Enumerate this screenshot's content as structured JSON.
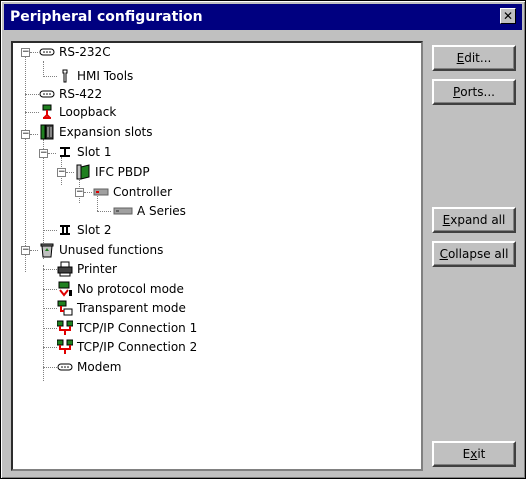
{
  "window": {
    "title": "Peripheral configuration"
  },
  "tree": {
    "rs232c": "RS-232C",
    "hmi_tools": "HMI Tools",
    "rs422": "RS-422",
    "loopback": "Loopback",
    "expansion_slots": "Expansion slots",
    "slot1": "Slot 1",
    "ifc_pbdp": "IFC PBDP",
    "controller": "Controller",
    "a_series": "A Series",
    "slot2": "Slot 2",
    "unused_functions": "Unused functions",
    "printer": "Printer",
    "no_protocol_mode": "No protocol mode",
    "transparent_mode": "Transparent mode",
    "tcpip1": "TCP/IP Connection 1",
    "tcpip2": "TCP/IP Connection 2",
    "modem": "Modem"
  },
  "buttons": {
    "edit_prefix": "E",
    "edit_rest": "dit...",
    "ports_prefix": "P",
    "ports_rest": "orts...",
    "expand_prefix": "E",
    "expand_rest": "xpand all",
    "collapse_prefix": "C",
    "collapse_rest": "ollapse all",
    "exit_prefix": "E",
    "exit_key": "x",
    "exit_rest": "it"
  },
  "icons": {
    "rs232c": "serial-port-icon",
    "hmi_tools": "wrench-icon",
    "rs422": "serial-port-icon",
    "loopback": "loopback-icon",
    "expansion_slots": "expansion-card-icon",
    "slot": "slot-icon",
    "ifc_pbdp": "card-icon",
    "controller": "controller-icon",
    "a_series": "plc-icon",
    "unused_functions": "recycle-bin-icon",
    "printer": "printer-icon",
    "no_protocol": "terminal-icon",
    "transparent": "transparent-icon",
    "tcpip": "network-icon",
    "modem": "modem-icon"
  }
}
